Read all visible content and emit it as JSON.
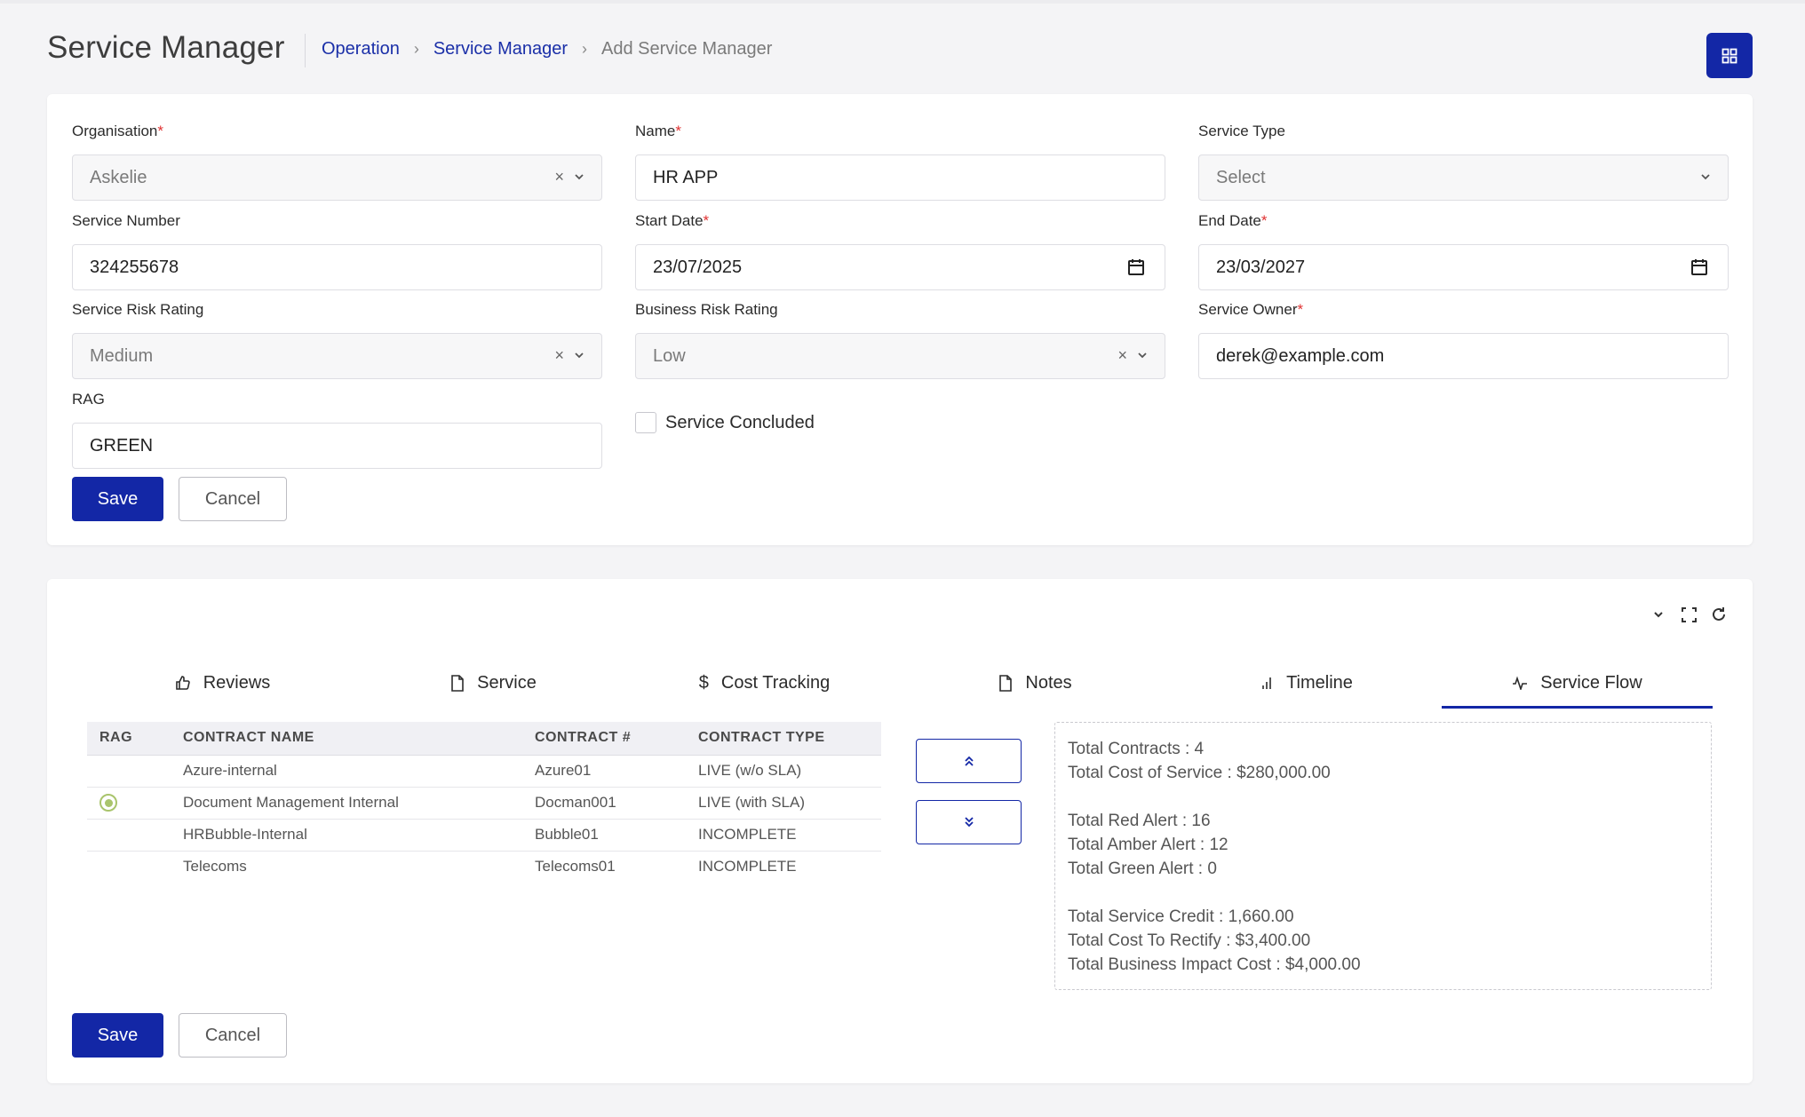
{
  "header": {
    "title": "Service Manager",
    "breadcrumb": [
      "Operation",
      "Service Manager",
      "Add Service Manager"
    ]
  },
  "form": {
    "organisation": {
      "label": "Organisation",
      "value": "Askelie"
    },
    "name": {
      "label": "Name",
      "value": "HR APP"
    },
    "service_type": {
      "label": "Service Type",
      "placeholder": "Select"
    },
    "service_number": {
      "label": "Service Number",
      "value": "324255678"
    },
    "start_date": {
      "label": "Start Date",
      "value": "23/07/2025"
    },
    "end_date": {
      "label": "End Date",
      "value": "23/03/2027"
    },
    "service_risk_rating": {
      "label": "Service Risk Rating",
      "value": "Medium"
    },
    "business_risk_rating": {
      "label": "Business Risk Rating",
      "value": "Low"
    },
    "service_owner": {
      "label": "Service Owner",
      "value": "derek@example.com"
    },
    "rag": {
      "label": "RAG",
      "value": "GREEN"
    },
    "service_concluded": {
      "label": "Service Concluded",
      "checked": false
    },
    "save_label": "Save",
    "cancel_label": "Cancel"
  },
  "tabs": [
    {
      "label": "Reviews",
      "icon": "thumbs-up-icon"
    },
    {
      "label": "Service",
      "icon": "file-icon"
    },
    {
      "label": "Cost Tracking",
      "icon": "dollar-icon"
    },
    {
      "label": "Notes",
      "icon": "file-icon"
    },
    {
      "label": "Timeline",
      "icon": "bar-chart-icon"
    },
    {
      "label": "Service Flow",
      "icon": "activity-icon",
      "active": true
    }
  ],
  "contracts": {
    "headers": [
      "RAG",
      "CONTRACT NAME",
      "CONTRACT #",
      "CONTRACT TYPE"
    ],
    "rows": [
      {
        "rag": "",
        "name": "Azure-internal",
        "number": "Azure01",
        "type": "LIVE (w/o SLA)"
      },
      {
        "rag": "selected",
        "name": "Document Management Internal",
        "number": "Docman001",
        "type": "LIVE (with SLA)"
      },
      {
        "rag": "",
        "name": "HRBubble-Internal",
        "number": "Bubble01",
        "type": "INCOMPLETE"
      },
      {
        "rag": "",
        "name": "Telecoms",
        "number": "Telecoms01",
        "type": "INCOMPLETE"
      }
    ]
  },
  "summary": {
    "total_contracts": "Total Contracts : 4",
    "total_cost": "Total Cost of Service : $280,000.00",
    "red_alert": "Total Red Alert : 16",
    "amber_alert": "Total Amber Alert : 12",
    "green_alert": "Total Green Alert : 0",
    "service_credit": "Total Service Credit : 1,660.00",
    "cost_to_rectify": "Total Cost To Rectify : $3,400.00",
    "business_impact": "Total Business Impact Cost : $4,000.00"
  },
  "bottom": {
    "save_label": "Save",
    "cancel_label": "Cancel"
  },
  "colors": {
    "primary": "#1327a6",
    "rag_green": "#a9c46c",
    "required": "#e03131"
  }
}
